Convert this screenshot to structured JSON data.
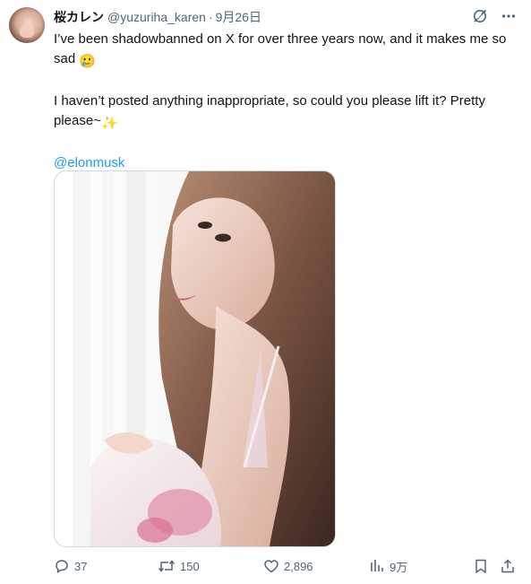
{
  "tweet": {
    "author": {
      "display_name": "桜カレン",
      "handle": "@yuzuriha_karen",
      "separator": "·",
      "date": "9月26日"
    },
    "lines": [
      "I’ve been shadowbanned on X for over three years now, and it makes me so sad",
      "I haven’t posted anything inappropriate, so could you please lift it? Pretty please~"
    ],
    "mention": "@elonmusk",
    "emojis": {
      "line1": "🥲",
      "line2": "✨"
    },
    "stats": {
      "replies": "37",
      "reposts": "150",
      "likes": "2,896",
      "views": "9万"
    }
  },
  "colors": {
    "text": "#0f1419",
    "secondary": "#536471",
    "link": "#1d9bf0"
  },
  "icons": [
    "grok-icon",
    "more-icon",
    "reply-icon",
    "repost-icon",
    "like-icon",
    "views-icon",
    "bookmark-icon",
    "share-icon"
  ]
}
